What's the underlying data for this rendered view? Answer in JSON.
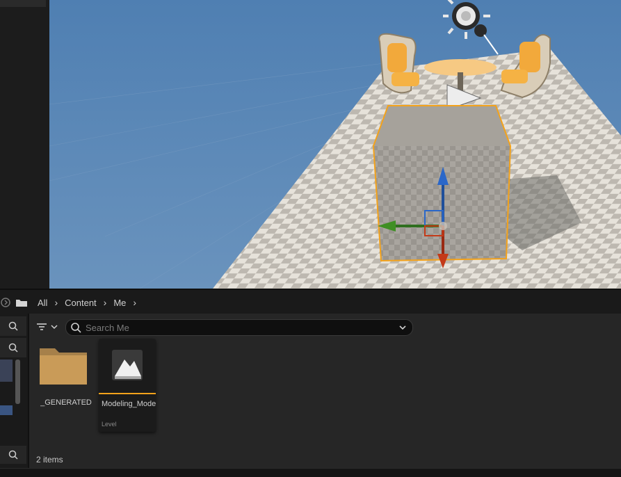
{
  "breadcrumb": {
    "items": [
      "All",
      "Content",
      "Me"
    ]
  },
  "search": {
    "placeholder": "Search Me"
  },
  "assets": [
    {
      "name": "_GENERATED",
      "type": "",
      "kind": "folder"
    },
    {
      "name": "Modeling_Mode",
      "type": "Level",
      "kind": "level"
    }
  ],
  "status": {
    "items_count": "2 items"
  },
  "colors": {
    "viewport_sky": "#5b86b5",
    "selection_outline": "#f3a21b",
    "folder": "#c79a57",
    "panel": "#262626"
  },
  "icons": [
    "history-icon",
    "folder-icon",
    "chevron-right-icon",
    "filter-icon",
    "chevron-down-icon",
    "search-icon",
    "light-source-icon",
    "player-start-icon",
    "transform-gizmo-icon"
  ]
}
